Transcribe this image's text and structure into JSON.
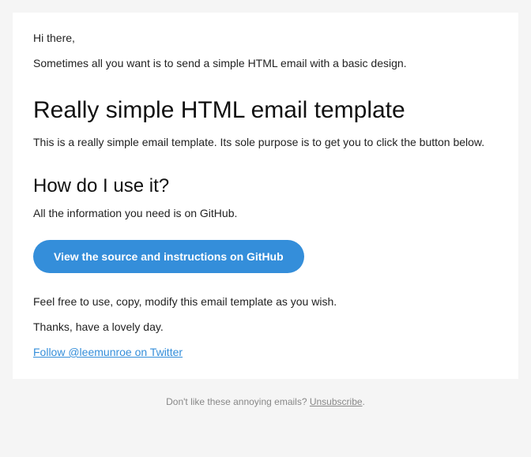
{
  "email": {
    "greeting": "Hi there,",
    "intro": "Sometimes all you want is to send a simple HTML email with a basic design.",
    "heading1": "Really simple HTML email template",
    "description": "This is a really simple email template. Its sole purpose is to get you to click the button below.",
    "heading2": "How do I use it?",
    "github_line": "All the information you need is on GitHub.",
    "cta_label": "View the source and instructions on GitHub",
    "free_use": "Feel free to use, copy, modify this email template as you wish.",
    "thanks": "Thanks, have a lovely day.",
    "twitter_link": "Follow @leemunroe on Twitter"
  },
  "footer": {
    "text": "Don't like these annoying emails? ",
    "unsubscribe": "Unsubscribe",
    "period": "."
  }
}
